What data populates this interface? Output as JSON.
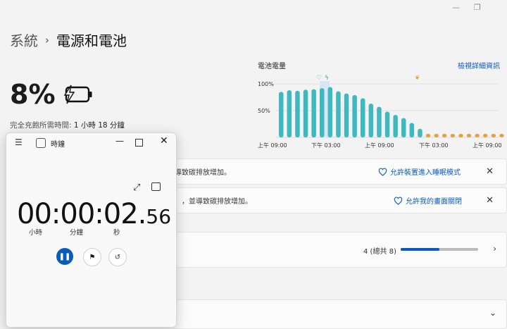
{
  "window": {
    "minimize": "—",
    "restore": "❐"
  },
  "breadcrumb": {
    "parent": "系統",
    "separator": "›",
    "current": "電源和電池"
  },
  "battery": {
    "percent": "8%",
    "full_charge_label": "完全充飽所需時間: ",
    "full_charge_value": "1 小時 18 分鐘"
  },
  "chart_header": {
    "title": "電池電量",
    "link": "檢視詳細資訊"
  },
  "chart_data": {
    "type": "bar",
    "y_ticks": [
      "100%",
      "50%"
    ],
    "ylim": [
      0,
      100
    ],
    "x_tick_labels": [
      "上午 09:00",
      "下午 03:00",
      "上午 09:00",
      "下午 03:00",
      "上午 09:00",
      "下午 03:00",
      "上午 09:00"
    ],
    "series": [
      {
        "color": "#3fb8c0",
        "values": [
          85,
          88,
          87,
          89,
          90,
          92,
          94,
          86,
          82,
          79,
          73,
          63,
          57,
          48,
          42,
          36,
          27,
          16
        ]
      },
      {
        "color": "#e6a23c",
        "values": [
          6,
          5,
          5,
          5,
          5,
          5,
          5,
          5,
          5,
          5,
          5
        ]
      }
    ],
    "markers": [
      {
        "icon": "heart-icon",
        "color": "#2aa7b2"
      },
      {
        "icon": "lightning-icon",
        "color": "#2aa7b2"
      },
      {
        "icon": "leaf-icon",
        "color": "#e6a23c"
      }
    ]
  },
  "recommendations": [
    {
      "message": "導致碳排放增加。",
      "action": "允許裝置進入睡眠模式",
      "close": "✕"
    },
    {
      "message": "，並導致碳排放增加。",
      "action": "允許我的畫面關閉",
      "close": "✕"
    }
  ],
  "progress_row": {
    "text": "4 (總共 8)",
    "progress": 0.5,
    "chevron": "›"
  },
  "collapsed_row": {
    "chevron": "⌄"
  },
  "clock": {
    "title": "時鐘",
    "menu": "☰",
    "minimize": "—",
    "close": "✕",
    "expand": "⤢",
    "time_main": "00:00:02.",
    "time_frac": "56",
    "units": {
      "hours": "小時",
      "minutes": "分鐘",
      "seconds": "秒"
    },
    "pause_glyph": "❚❚",
    "flag_glyph": "⚑",
    "reset_glyph": "↺"
  }
}
